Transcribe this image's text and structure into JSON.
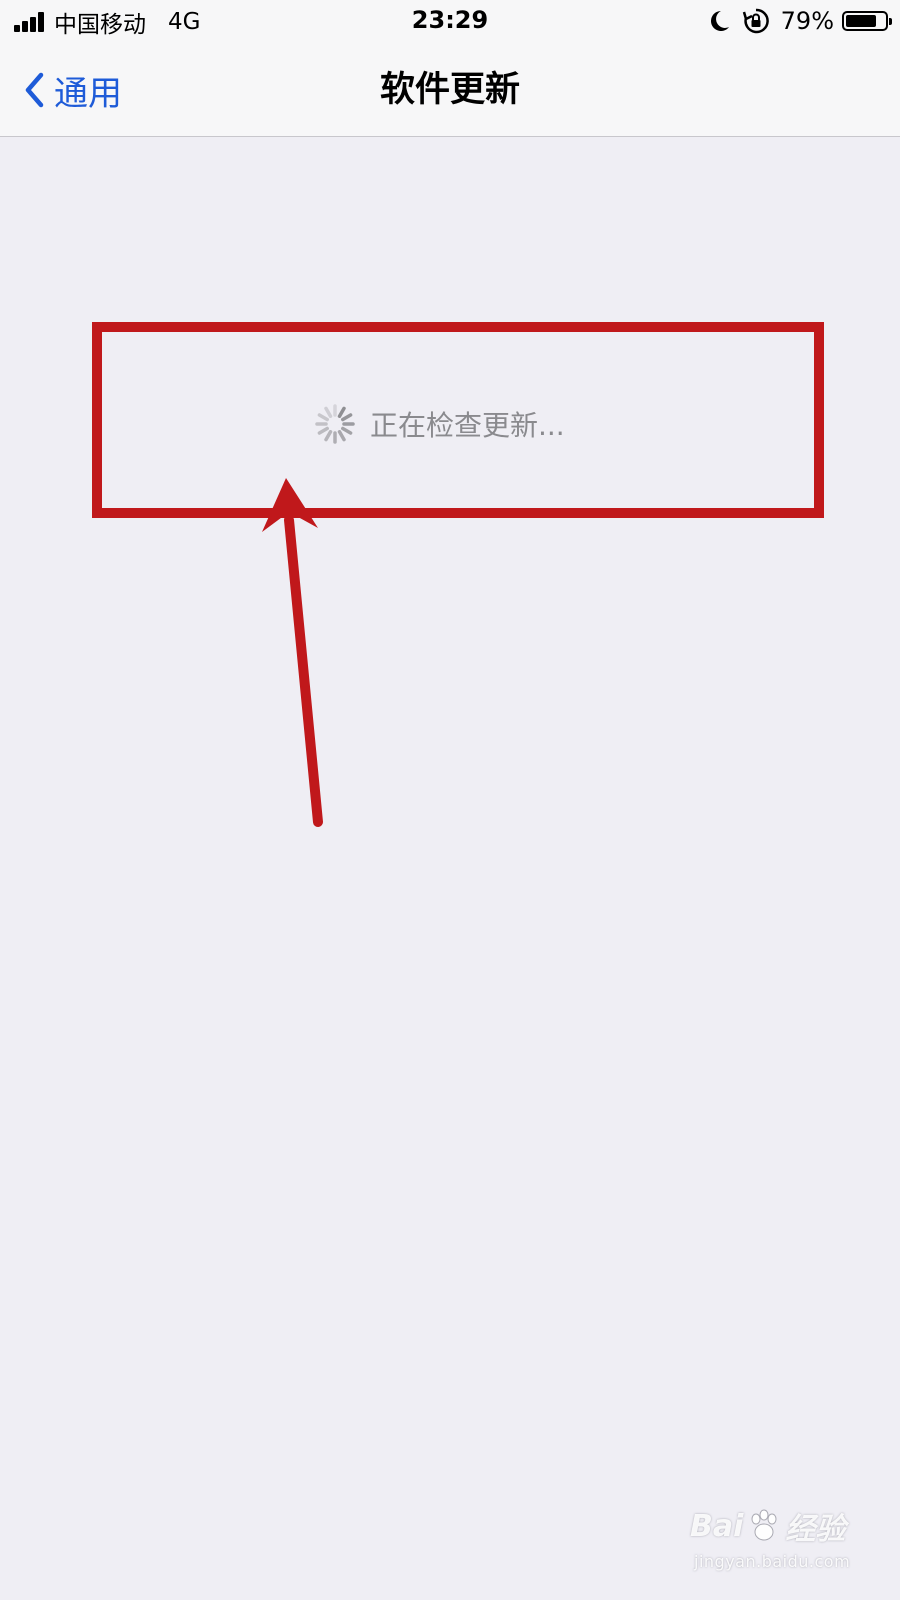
{
  "status_bar": {
    "carrier": "中国移动",
    "network": "4G",
    "time": "23:29",
    "battery_percent": "79%",
    "battery_level": 0.79
  },
  "nav": {
    "back_label": "通用",
    "title": "软件更新"
  },
  "main": {
    "checking_text": "正在检查更新..."
  },
  "annotation": {
    "color": "#c0181b"
  },
  "watermark": {
    "logo_text_left": "Bai",
    "logo_text_right": "经验",
    "url": "jingyan.baidu.com"
  },
  "colors": {
    "ios_blue": "#1e5bd8",
    "background": "#efeef4"
  }
}
